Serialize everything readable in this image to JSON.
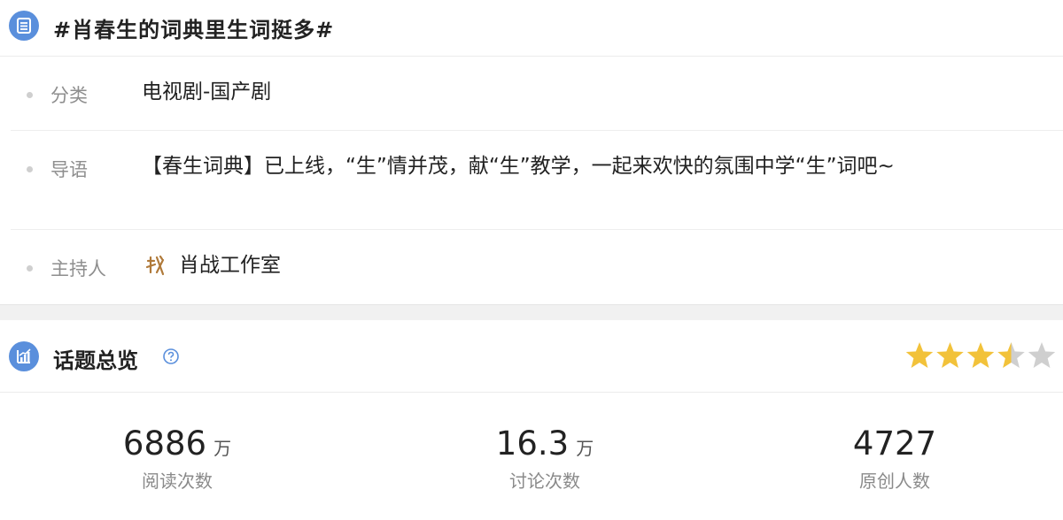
{
  "topic": {
    "title": "#肖春生的词典里生词挺多#"
  },
  "info": {
    "category": {
      "label": "分类",
      "value": "电视剧-国产剧"
    },
    "intro": {
      "label": "导语",
      "value": "【春生词典】已上线，“生”情并茂，献“生”教学，一起来欢快的氛围中学“生”词吧~"
    },
    "host": {
      "label": "主持人",
      "value": "肖战工作室",
      "avatar_text": "戏"
    }
  },
  "overview": {
    "title": "话题总览",
    "rating_stars": 3.5,
    "rating_max": 5,
    "star_color": "#f2c23a",
    "star_empty_color": "#cfcfcf"
  },
  "stats": [
    {
      "value": "6886",
      "unit": "万",
      "label": "阅读次数"
    },
    {
      "value": "16.3",
      "unit": "万",
      "label": "讨论次数"
    },
    {
      "value": "4727",
      "unit": "",
      "label": "原创人数"
    }
  ],
  "colors": {
    "icon_blue": "#5a8fdc",
    "text_dark": "#222222",
    "text_gray": "#8e8e8e"
  }
}
